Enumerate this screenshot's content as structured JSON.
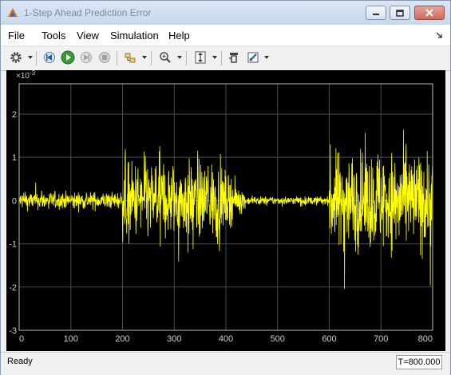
{
  "window": {
    "title": "1-Step Ahead Prediction Error",
    "icon": "matlab-scope-icon"
  },
  "menu": {
    "items": [
      "File",
      "Tools",
      "View",
      "Simulation",
      "Help"
    ]
  },
  "toolbar": {
    "icons": [
      "gear-icon",
      "step-back-icon",
      "run-icon",
      "stop-icon",
      "signal-selection-icon",
      "zoom-icon",
      "scale-axes-icon",
      "restore-icon",
      "highlight-icon"
    ]
  },
  "status": {
    "text": "Ready",
    "time": "T=800.000"
  },
  "chart_data": {
    "type": "line",
    "title": "",
    "xlabel": "",
    "ylabel": "",
    "exponent_label": "×10",
    "exponent_power": "-3",
    "xlim": [
      0,
      800
    ],
    "ylim": [
      -3,
      2.7
    ],
    "x_ticks": [
      "0",
      "100",
      "200",
      "300",
      "400",
      "500",
      "600",
      "700",
      "800"
    ],
    "y_ticks": [
      "-3",
      "-2",
      "-1",
      "0",
      "1",
      "2"
    ],
    "grid": true,
    "background": "#000000",
    "line_color": "#ffff00",
    "segments": [
      {
        "from": 0,
        "to": 200,
        "amplitude": 0.25
      },
      {
        "from": 200,
        "to": 400,
        "amplitude": 1.1
      },
      {
        "from": 400,
        "to": 600,
        "amplitude": 0.12
      },
      {
        "from": 600,
        "to": 800,
        "amplitude": 1.4
      }
    ]
  }
}
